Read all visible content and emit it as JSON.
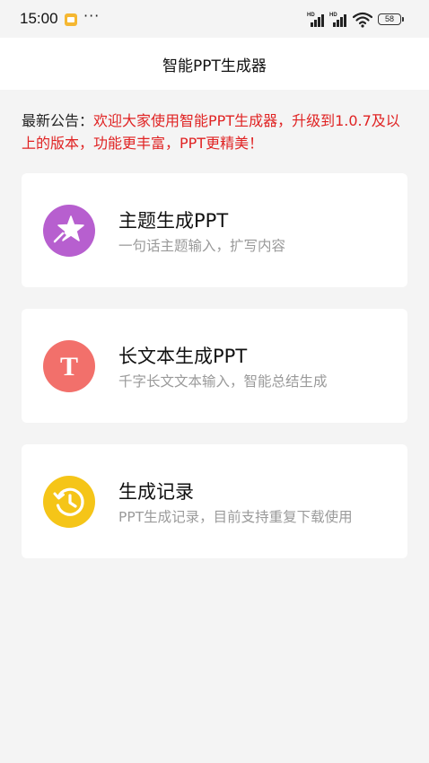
{
  "status_bar": {
    "time": "15:00",
    "more": "···",
    "signal_tag_1": "HD",
    "signal_tag_2": "HD",
    "battery": "58"
  },
  "header": {
    "title": "智能PPT生成器"
  },
  "announcement": {
    "label": "最新公告：",
    "message": "欢迎大家使用智能PPT生成器，升级到1.0.7及以上的版本，功能更丰富，PPT更精美！"
  },
  "cards": [
    {
      "title": "主题生成PPT",
      "subtitle": "一句话主题输入，扩写内容",
      "icon": "star-icon",
      "color": "#b75fcf"
    },
    {
      "title": "长文本生成PPT",
      "subtitle": "千字长文文本输入，智能总结生成",
      "icon": "text-icon",
      "icon_letter": "T",
      "color": "#f2706b"
    },
    {
      "title": "生成记录",
      "subtitle": "PPT生成记录，目前支持重复下载使用",
      "icon": "clock-icon",
      "color": "#f5c518"
    }
  ],
  "colors": {
    "background": "#f4f4f4",
    "announcement_text": "#e02323",
    "subtitle_text": "#9a9a9a"
  }
}
